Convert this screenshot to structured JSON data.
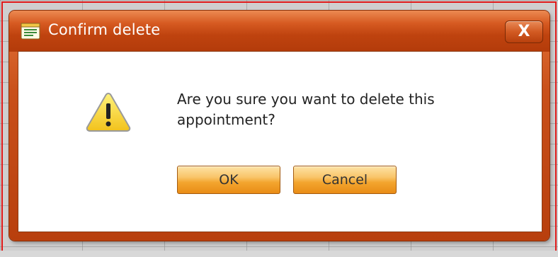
{
  "dialog": {
    "title": "Confirm delete",
    "close_label": "X",
    "message": "Are you sure you want to delete this appointment?",
    "ok_label": "OK",
    "cancel_label": "Cancel",
    "title_icon": "calendar-window-icon",
    "warning_icon": "warning-triangle-icon"
  },
  "colors": {
    "titlebar": "#c9501a",
    "frame_highlight": "#e01a1a",
    "button_fill": "#f6b146"
  }
}
